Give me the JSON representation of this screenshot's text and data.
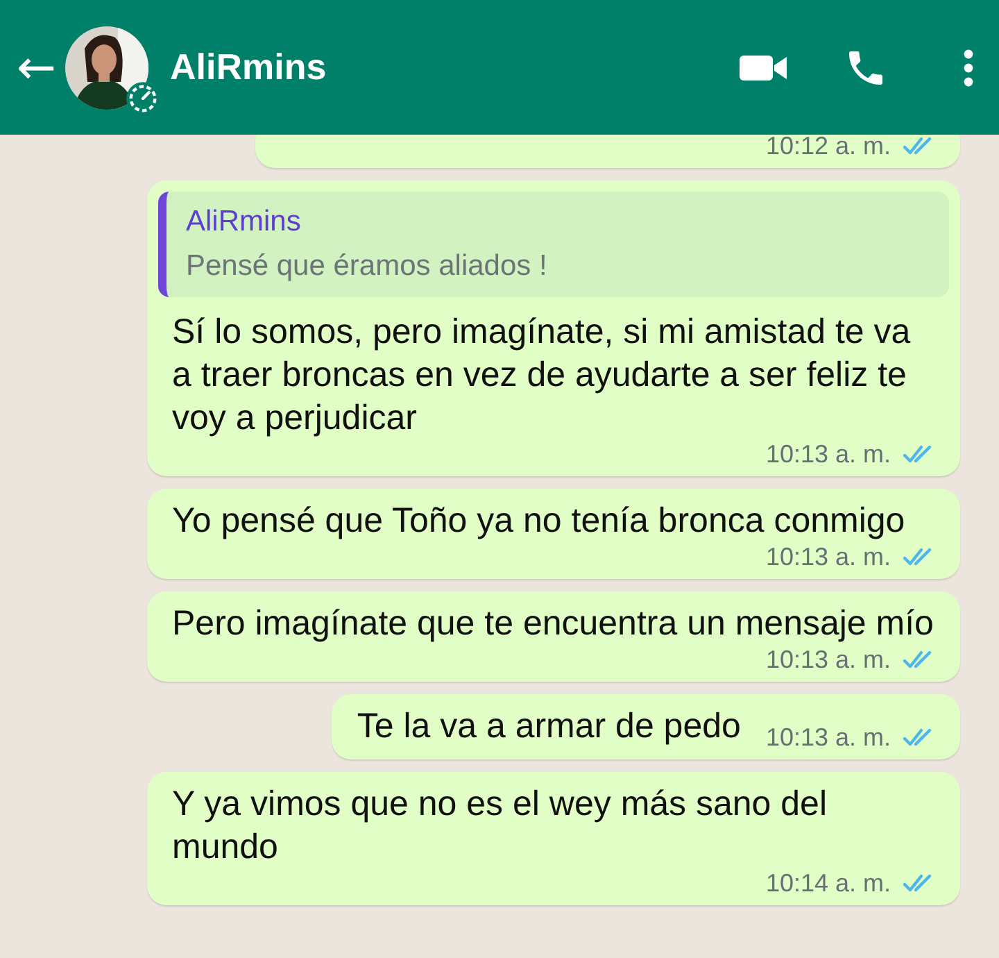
{
  "header": {
    "back": "←",
    "name": "AliRmins"
  },
  "messages": [
    {
      "time": "10:12 a. m.",
      "read": true,
      "partial": true
    },
    {
      "text": "Sí lo somos, pero imagínate, si mi amistad te va a traer broncas en vez de ayudarte a ser feliz te voy a perjudicar",
      "time": "10:13 a. m.",
      "read": true,
      "partial": false,
      "quote": {
        "author": "AliRmins",
        "text": "Pensé que éramos aliados !"
      }
    },
    {
      "text": "Yo pensé que Toño ya no tenía bronca conmigo",
      "time": "10:13 a. m.",
      "read": true,
      "partial": false
    },
    {
      "text": "Pero imagínate que te encuentra un mensaje mío",
      "time": "10:13 a. m.",
      "read": true,
      "partial": false
    },
    {
      "text": "Te la va a armar de pedo",
      "time": "10:13 a. m.",
      "read": true,
      "partial": false
    },
    {
      "text": "Y ya vimos que no es el wey más sano del mundo",
      "time": "10:14 a. m.",
      "read": true,
      "partial": false
    }
  ]
}
